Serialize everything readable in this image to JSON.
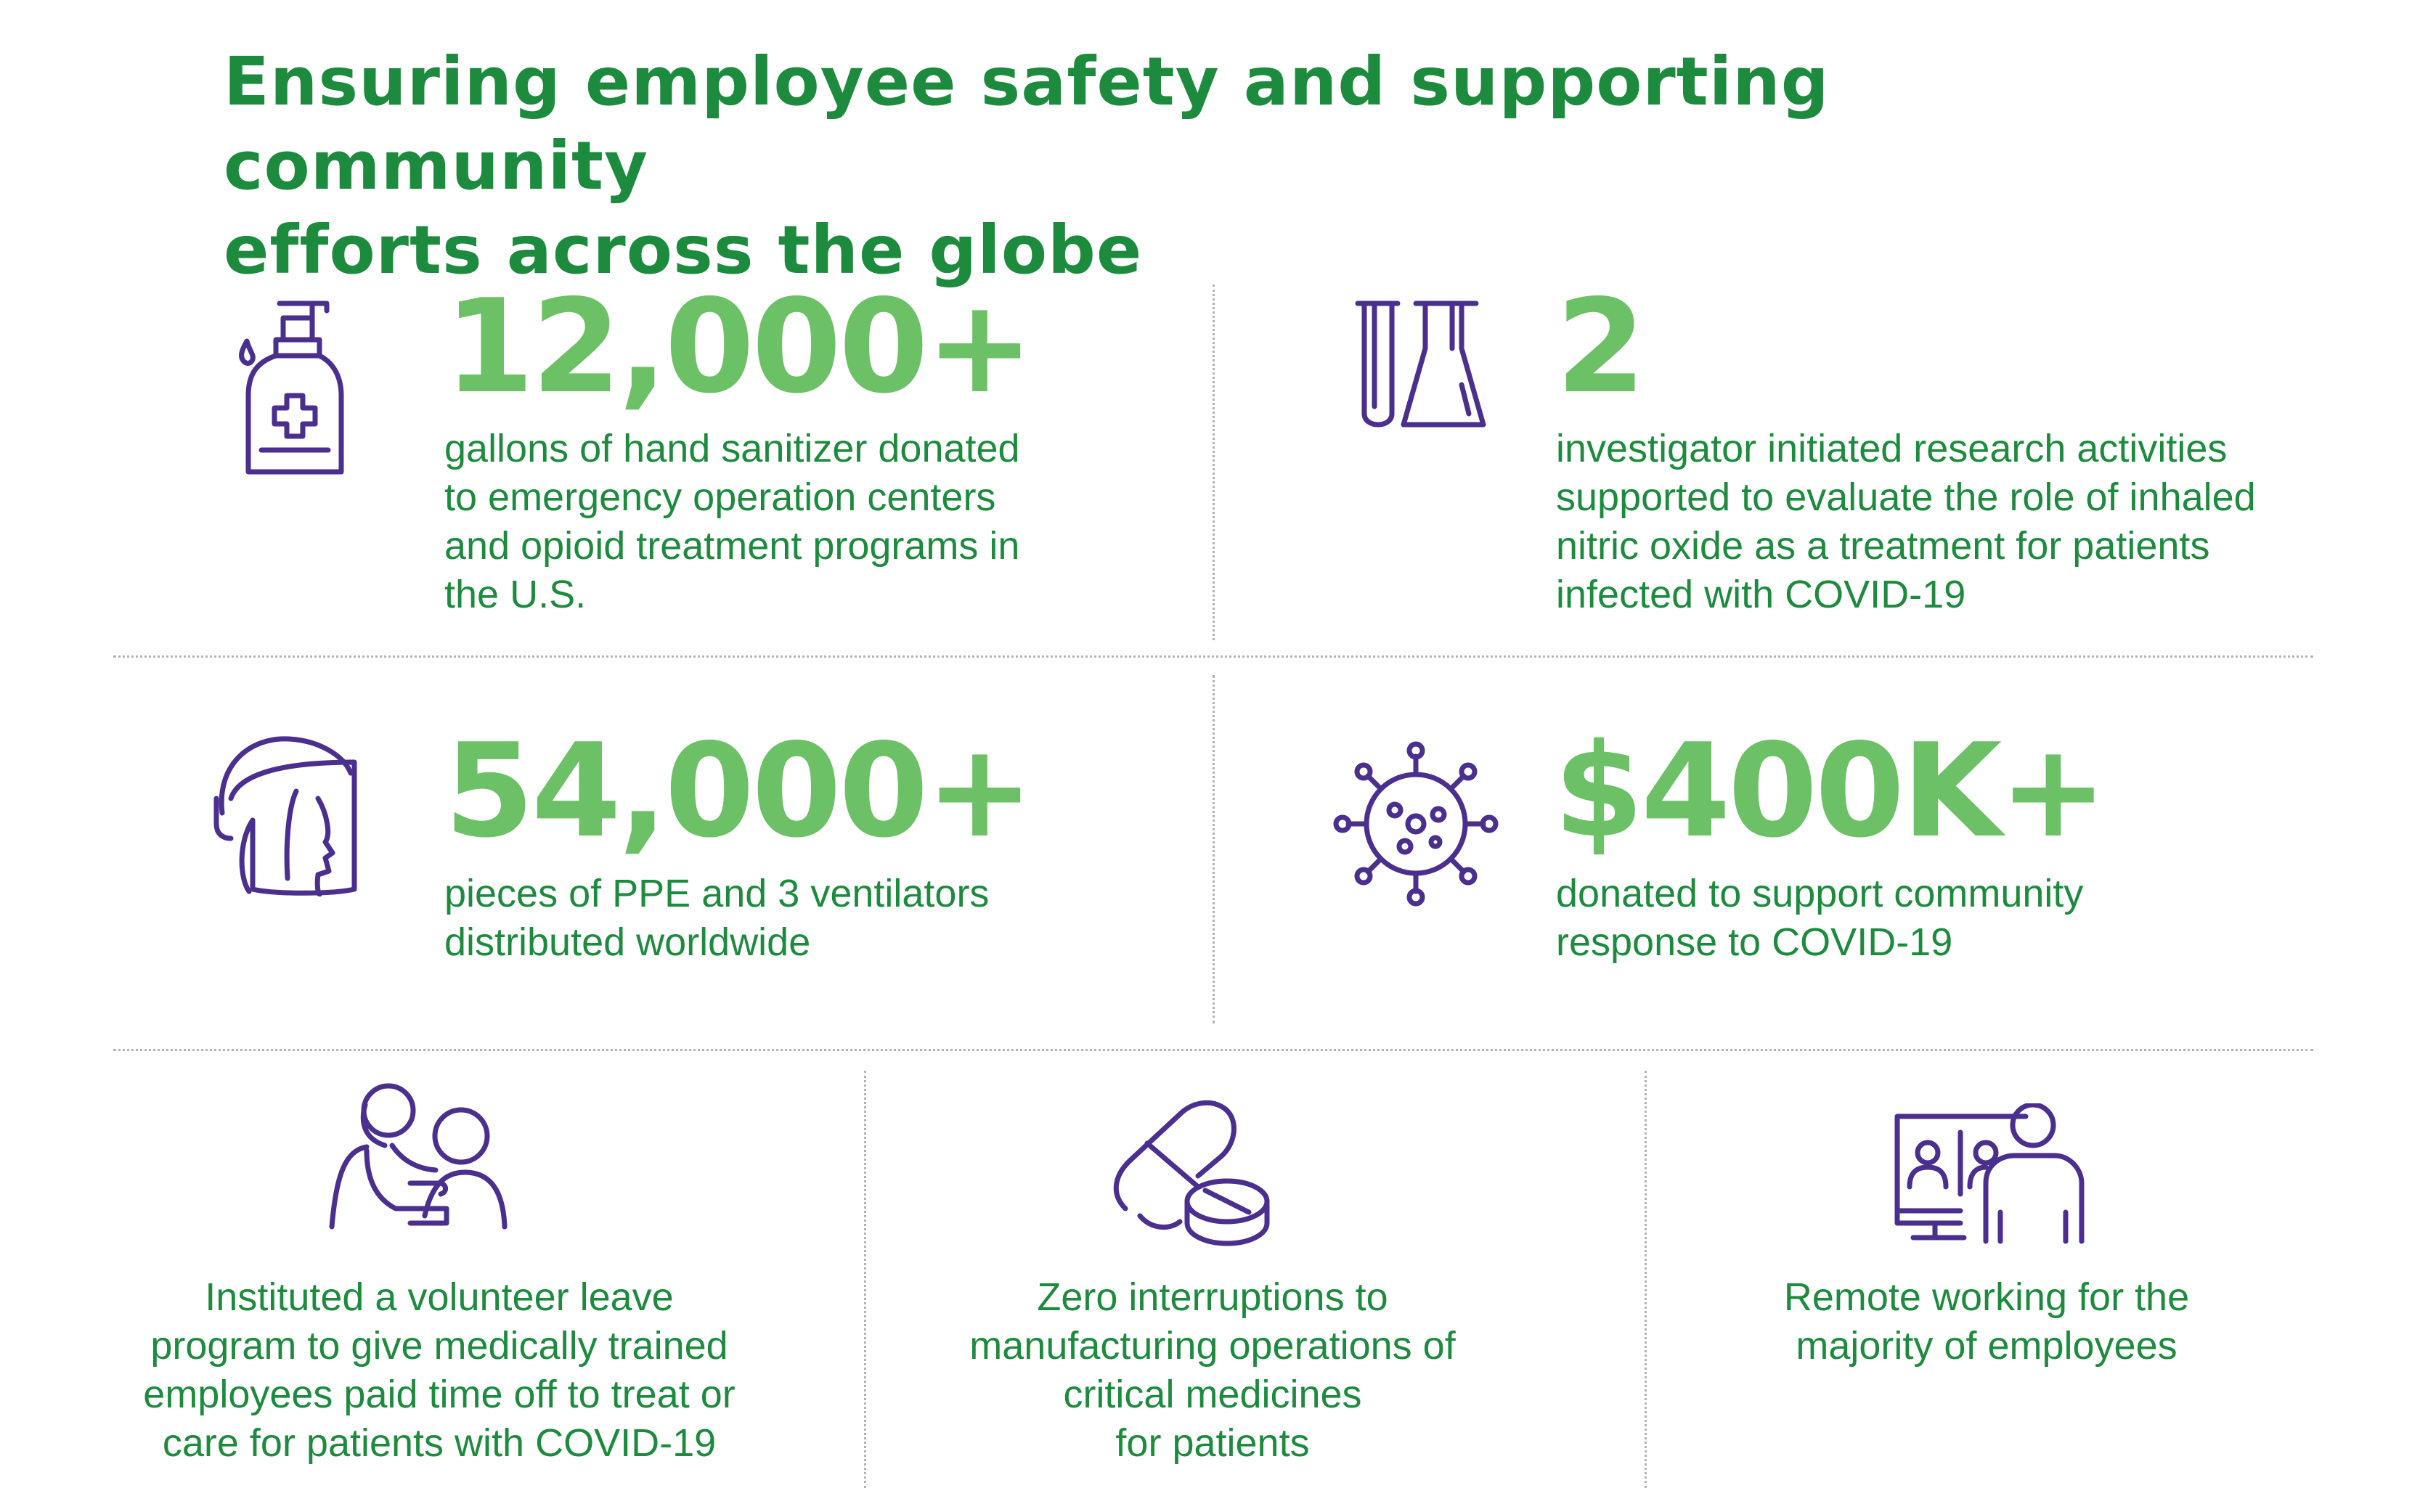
{
  "title": {
    "line1": "Ensuring employee safety and supporting community",
    "line2": "efforts across the globe"
  },
  "colors": {
    "heading": "#1c8b3d",
    "stat": "#6cc166",
    "icon": "#4a2f8f",
    "divider": "#b3b3b3"
  },
  "stats": [
    {
      "icon": "hand-sanitizer-icon",
      "value": "12,000+",
      "lines": [
        "gallons of hand sanitizer donated",
        "to emergency operation centers",
        "and opioid treatment programs in",
        "the U.S."
      ]
    },
    {
      "icon": "lab-glassware-icon",
      "value": "2",
      "lines": [
        "investigator initiated research activities",
        "supported to evaluate the role of inhaled",
        "nitric oxide as a treatment for patients",
        "infected with COVID-19"
      ]
    },
    {
      "icon": "face-shield-icon",
      "value": "54,000+",
      "lines": [
        "pieces of PPE and 3 ventilators",
        "distributed worldwide"
      ]
    },
    {
      "icon": "virus-icon",
      "value": "$400K+",
      "lines": [
        "donated to support community",
        "response to COVID-19"
      ]
    }
  ],
  "initiatives": [
    {
      "icon": "doctor-patient-icon",
      "lines": [
        "Instituted a volunteer leave",
        "program to give medically trained",
        "employees paid time off to treat or",
        "care for patients with COVID-19"
      ]
    },
    {
      "icon": "pills-icon",
      "lines": [
        "Zero interruptions to",
        "manufacturing operations of",
        "critical medicines",
        "for patients"
      ]
    },
    {
      "icon": "remote-meeting-icon",
      "lines": [
        "Remote working for the",
        "majority of employees"
      ]
    }
  ]
}
